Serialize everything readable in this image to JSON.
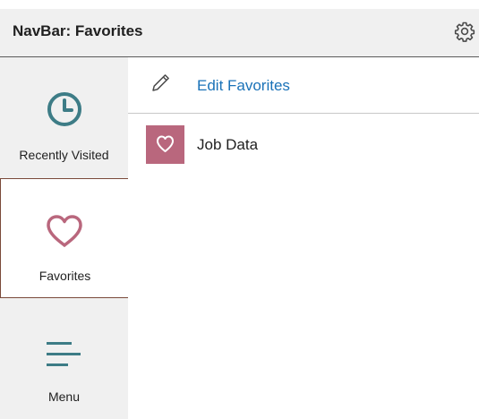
{
  "header": {
    "title": "NavBar: Favorites",
    "settings_icon": "gear-icon"
  },
  "sidebar": {
    "items": [
      {
        "label": "Recently Visited",
        "icon": "clock-icon",
        "selected": false
      },
      {
        "label": "Favorites",
        "icon": "heart-icon",
        "selected": true
      },
      {
        "label": "Menu",
        "icon": "menu-lines-icon",
        "selected": false
      }
    ]
  },
  "main": {
    "edit": {
      "label": "Edit Favorites",
      "icon": "pencil-icon"
    },
    "favorites": [
      {
        "label": "Job Data",
        "icon": "heart-icon"
      }
    ]
  },
  "colors": {
    "accent_teal": "#3d7c86",
    "heart_rose": "#b9677d",
    "link_blue": "#1a72b8",
    "panel_gray": "#f0f0f0"
  }
}
